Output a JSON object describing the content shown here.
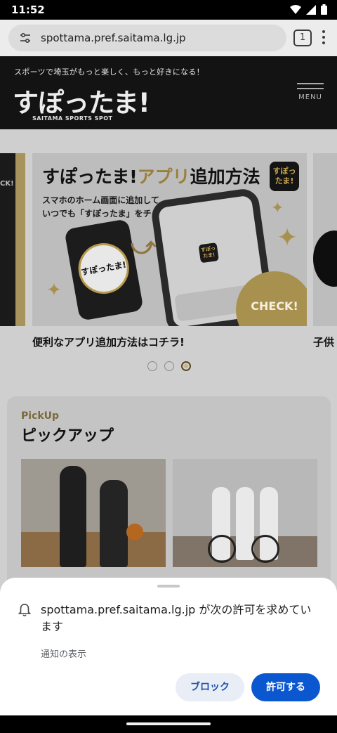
{
  "status_bar": {
    "time": "11:52",
    "icons": [
      "wifi-icon",
      "signal-icon",
      "battery-icon"
    ]
  },
  "browser": {
    "url": "spottama.pref.saitama.lg.jp",
    "tab_count": "1"
  },
  "site_header": {
    "tagline": "スポーツで埼玉がもっと楽しく、もっと好きになる！",
    "logo_text": "すぽったま!",
    "logo_subtext": "SAITAMA SPORTS SPOT",
    "menu_label": "MENU"
  },
  "carousel": {
    "prev_slide_text": "CK!",
    "banner": {
      "title_part1": "すぽったま!",
      "title_part2": "アプリ",
      "title_part3": "追加方法",
      "badge": "すぽったま!",
      "subtitle_line1": "スマホのホーム画面に追加して",
      "subtitle_line2": "いつでも「すぽったま」をチェック！",
      "phone_logo": "すぽったま!",
      "phone_chip": "すぽったま!",
      "check_label": "CHECK!"
    },
    "caption": "便利なアプリ追加方法はコチラ!",
    "next_caption": "子供",
    "dots": [
      false,
      false,
      true
    ]
  },
  "pickup": {
    "heading_en": "PickUp",
    "heading_ja": "ピックアップ"
  },
  "permission_sheet": {
    "message": "spottama.pref.saitama.lg.jp が次の許可を求めています",
    "permission": "通知の表示",
    "block_label": "ブロック",
    "allow_label": "許可する"
  },
  "colors": {
    "accent_gold": "#a8914f",
    "allow_blue": "#0b57d0",
    "header_bg": "#131313"
  }
}
